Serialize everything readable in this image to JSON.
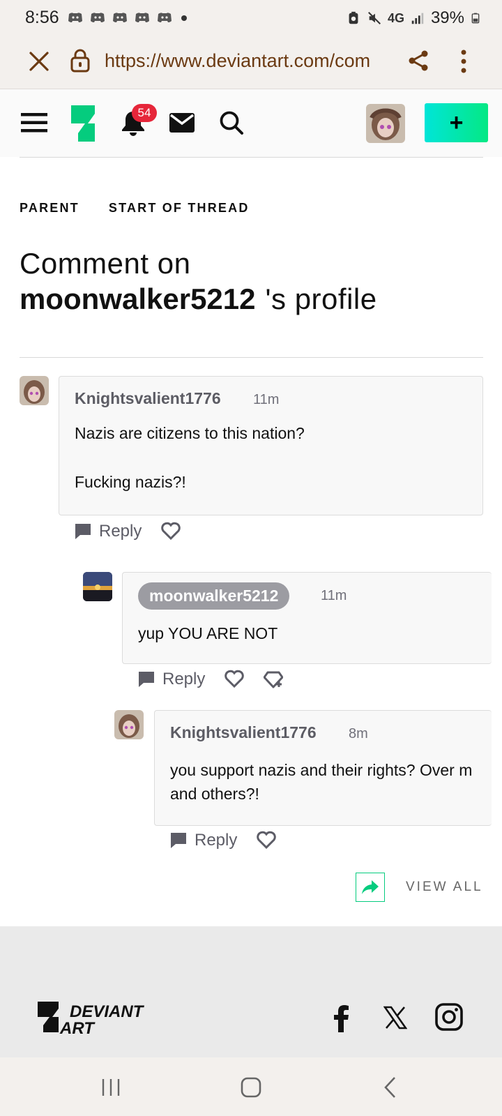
{
  "status_bar": {
    "time": "8:56",
    "battery_percent": "39%",
    "network": "4G"
  },
  "browser": {
    "url": "https://www.deviantart.com/com"
  },
  "nav": {
    "notification_count": "54",
    "create_label": "+"
  },
  "thread": {
    "parent_label": "PARENT",
    "start_label": "START OF THREAD",
    "heading_line1": "Comment on",
    "profile_name": "moonwalker5212",
    "profile_suffix": "'s profile"
  },
  "comments": [
    {
      "author": "Knightsvalient1776",
      "time": "11m",
      "lines": [
        "Nazis are citizens to this nation?",
        "Fucking nazis?!"
      ],
      "reply_label": "Reply"
    },
    {
      "author": "moonwalker5212",
      "time": "11m",
      "lines": [
        "yup YOU ARE NOT"
      ],
      "reply_label": "Reply"
    },
    {
      "author": "Knightsvalient1776",
      "time": "8m",
      "lines": [
        "you support nazis and their rights?  Over m",
        "and others?!"
      ],
      "reply_label": "Reply"
    }
  ],
  "view_all_label": "VIEW ALL",
  "footer": {
    "logo_text_1": "DEVIANT",
    "logo_text_2": "ART"
  },
  "colors": {
    "accent_green": "#05cc7e",
    "badge_red": "#e6263a",
    "url_brown": "#6b3a12"
  },
  "icons": [
    "close-icon",
    "lock-icon",
    "share-icon",
    "more-vert-icon",
    "hamburger-icon",
    "deviantart-logo-icon",
    "bell-icon",
    "mail-icon",
    "search-icon",
    "comment-icon",
    "heart-icon",
    "gem-plus-icon",
    "facebook-icon",
    "x-icon",
    "instagram-icon"
  ]
}
